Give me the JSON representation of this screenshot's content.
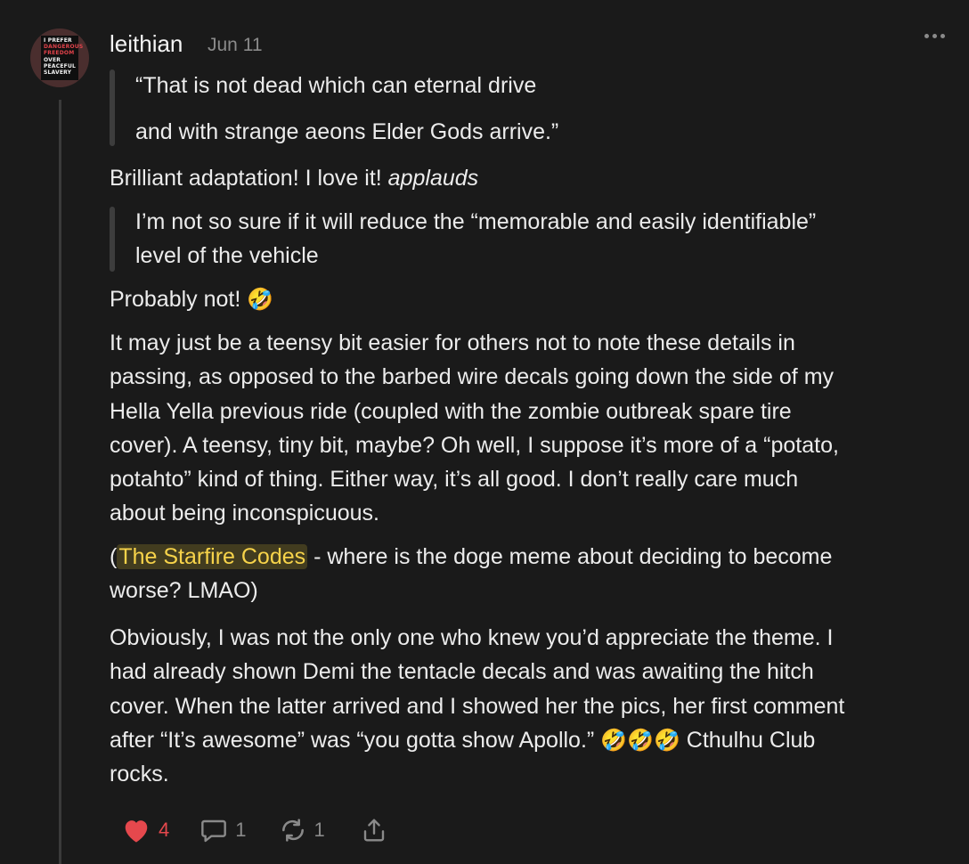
{
  "post": {
    "author": "leithian",
    "date": "Jun 11",
    "avatar": {
      "lines": [
        {
          "text": "I PREFER",
          "color": "white"
        },
        {
          "text": "DANGEROUS",
          "color": "red"
        },
        {
          "text": "FREEDOM",
          "color": "red"
        },
        {
          "text": "OVER",
          "color": "white"
        },
        {
          "text": "PEACEFUL",
          "color": "white"
        },
        {
          "text": "SLAVERY",
          "color": "white"
        }
      ]
    },
    "more_icon": "more-horizontal-icon",
    "quote1": {
      "line1": "“That is not dead which can eternal drive",
      "line2": "and with strange aeons Elder Gods arrive.”"
    },
    "para1": {
      "text": "Brilliant adaptation! I love it! ",
      "italic": "applauds"
    },
    "quote2": {
      "line1": "I’m not so sure if it will reduce the “memorable and easily identifiable”",
      "line2": "level of the vehicle"
    },
    "para2": {
      "text": "Probably not! ",
      "emoji": "🤣"
    },
    "para3": {
      "line1": "It may just be a teensy bit easier for others not to note these details in",
      "line2": "passing, as opposed to the barbed wire decals going down the side of my",
      "line3": "Hella Yella previous ride (coupled with the zombie outbreak spare tire",
      "line4": "cover). A teensy, tiny bit, maybe? Oh well, I suppose it’s more of a “potato,",
      "line5": "potahto” kind of thing. Either way, it’s all good. I don’t really care much",
      "line6": "about being inconspicuous."
    },
    "para4": {
      "open_paren": "(",
      "mention": "The Starfire Codes",
      "rest1": " - where is the doge meme about deciding to become",
      "line2": "worse? LMAO)"
    },
    "para5": {
      "line1": "Obviously, I was not the only one who knew you’d appreciate the theme. I",
      "line2": "had already shown Demi the tentacle decals and was awaiting the hitch",
      "line3": "cover. When the latter arrived and I showed her the pics, her first comment",
      "line4_before": "after “It’s awesome” was “you gotta show Apollo.” ",
      "emojis": "🤣🤣🤣",
      "line4_after": " Cthulhu Club",
      "line5": "rocks."
    },
    "actions": {
      "likes": "4",
      "comments": "1",
      "restacks": "1",
      "like_color": "#e5484d"
    }
  }
}
